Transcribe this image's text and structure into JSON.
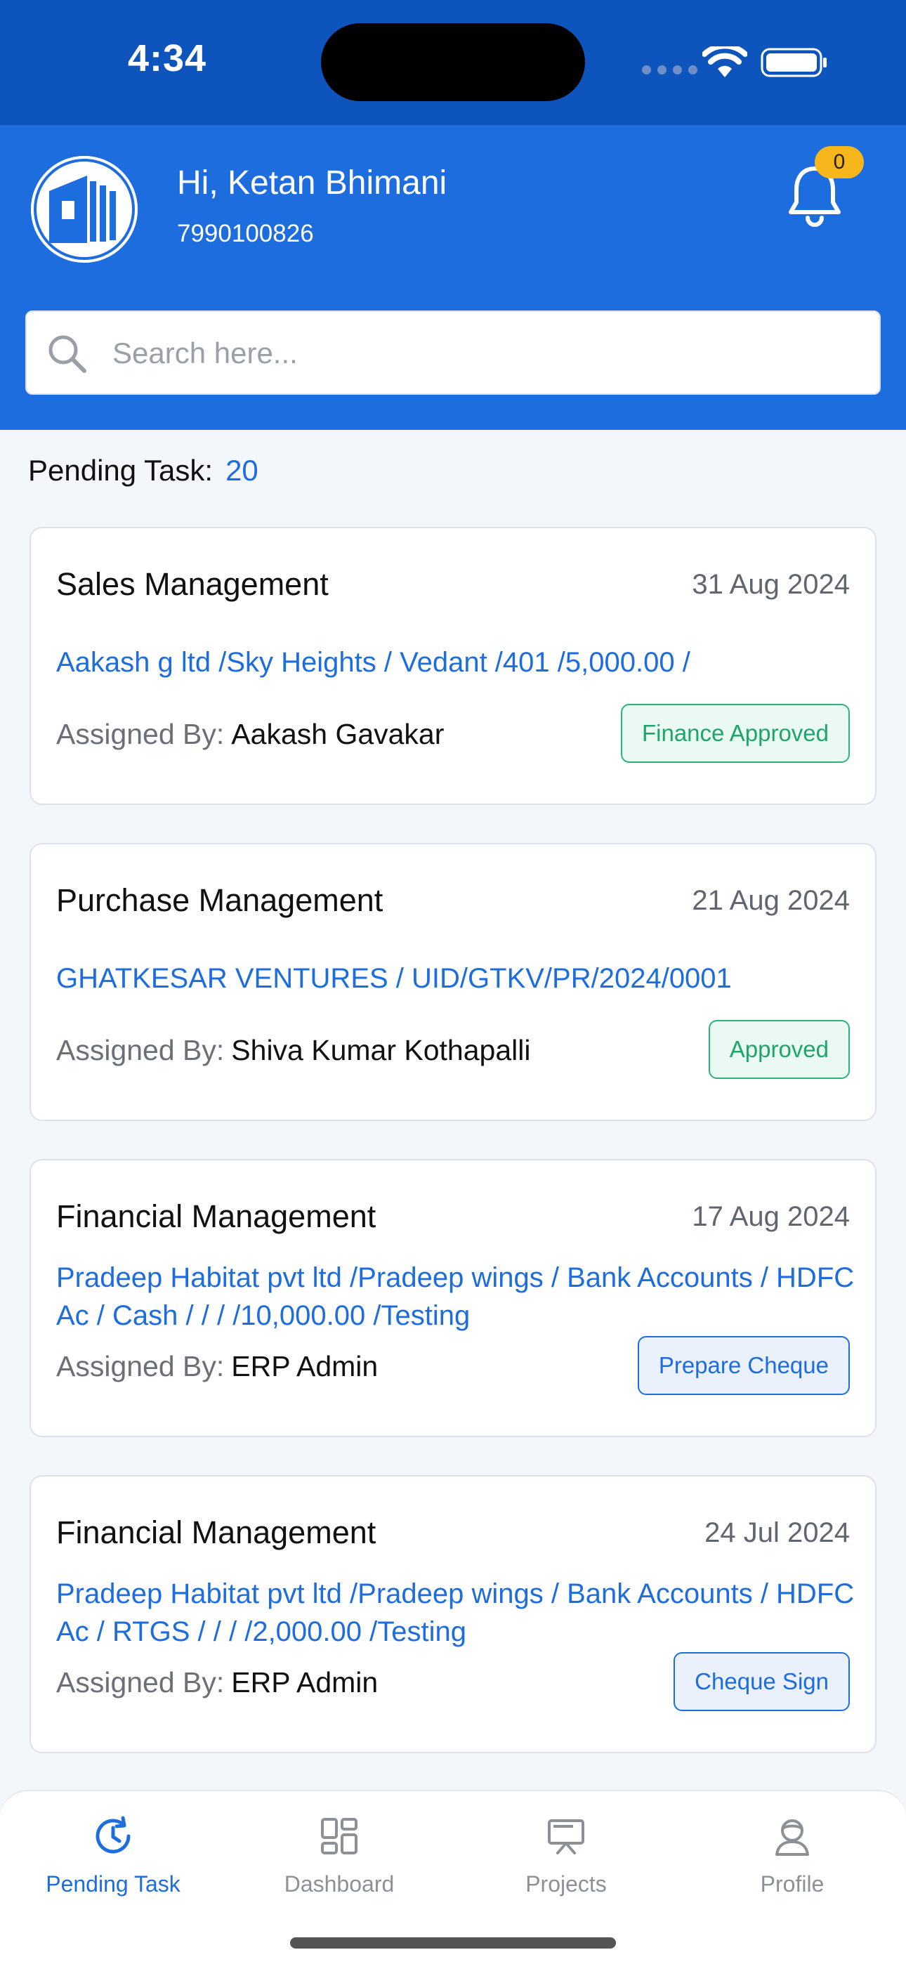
{
  "status_bar": {
    "time": "4:34"
  },
  "header": {
    "greeting": "Hi, Ketan Bhimani",
    "phone": "7990100826",
    "notification_count": "0",
    "accent": "#1e6ddf"
  },
  "search": {
    "placeholder": "Search here..."
  },
  "pending": {
    "label": "Pending Task:",
    "count": "20"
  },
  "tasks": [
    {
      "title": "Sales Management",
      "date": "31 Aug 2024",
      "description": "Aakash g ltd /Sky Heights / Vedant /401 /5,000.00 /",
      "assigned_label": "Assigned By:",
      "assigned_by": "Aakash Gavakar",
      "status": "Finance Approved"
    },
    {
      "title": "Purchase Management",
      "date": "21 Aug 2024",
      "description": "GHATKESAR VENTURES / UID/GTKV/PR/2024/0001",
      "assigned_label": "Assigned By:",
      "assigned_by": "Shiva Kumar Kothapalli",
      "status": "Approved"
    },
    {
      "title": "Financial Management",
      "date": "17 Aug 2024",
      "description": "Pradeep Habitat pvt ltd /Pradeep wings / Bank Accounts / HDFC Ac / Cash /  / / /10,000.00 /Testing",
      "assigned_label": "Assigned By:",
      "assigned_by": "ERP Admin",
      "status": "Prepare Cheque"
    },
    {
      "title": "Financial Management",
      "date": "24 Jul 2024",
      "description": "Pradeep Habitat pvt ltd /Pradeep wings / Bank Accounts / HDFC Ac / RTGS /  / / /2,000.00 /Testing",
      "assigned_label": "Assigned By:",
      "assigned_by": "ERP Admin",
      "status": "Cheque Sign"
    }
  ],
  "tabbar": {
    "items": [
      {
        "label": "Pending Task",
        "icon": "clock-icon",
        "active": true
      },
      {
        "label": "Dashboard",
        "icon": "dashboard-icon",
        "active": false
      },
      {
        "label": "Projects",
        "icon": "presentation-icon",
        "active": false
      },
      {
        "label": "Profile",
        "icon": "user-icon",
        "active": false
      }
    ]
  }
}
